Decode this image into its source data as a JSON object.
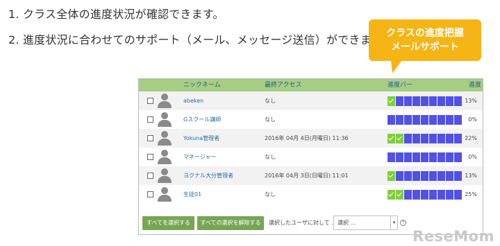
{
  "intro": {
    "line1": "1. クラス全体の進度状況が確認できます。",
    "line2": "2. 進度状況に合わせてのサポート（メール、メッセージ送信）ができます。"
  },
  "callout": {
    "line1": "クラスの進度把握",
    "line2": "メールサポート"
  },
  "table": {
    "headers": {
      "nickname": "ニックネーム",
      "last_access": "最終アクセス",
      "progress_bar": "進度バー",
      "progress": "進度"
    },
    "rows": [
      {
        "nickname": "abeken",
        "last_access": "なし",
        "progress": "13%",
        "done_segments": 1
      },
      {
        "nickname": "Gスクール講師",
        "last_access": "なし",
        "progress": "0%",
        "done_segments": 0
      },
      {
        "nickname": "Yokuna管理者",
        "last_access": "2016年 04月 4日(月曜日) 11:36",
        "progress": "22%",
        "done_segments": 2
      },
      {
        "nickname": "マネージャー",
        "last_access": "なし",
        "progress": "0%",
        "done_segments": 0
      },
      {
        "nickname": "ヨクナル大分管理者",
        "last_access": "2016年 04月 3日(日曜日) 11:01",
        "progress": "13%",
        "done_segments": 1
      },
      {
        "nickname": "生徒01",
        "last_access": "なし",
        "progress": "25%",
        "done_segments": 2
      }
    ],
    "total_segments": 9
  },
  "footer": {
    "select_all": "すべてを選択する",
    "deselect_all": "すべての選択を解除する",
    "action_label": "選択したユーザに対して ...",
    "select_value": "選択 ..."
  },
  "watermark": "ReseMom",
  "colors": {
    "header_bg": "#a7ce85",
    "segment_done": "#7fcf3c",
    "segment_todo": "#5151e6",
    "button": "#76a653",
    "callout": "#f5b515"
  }
}
